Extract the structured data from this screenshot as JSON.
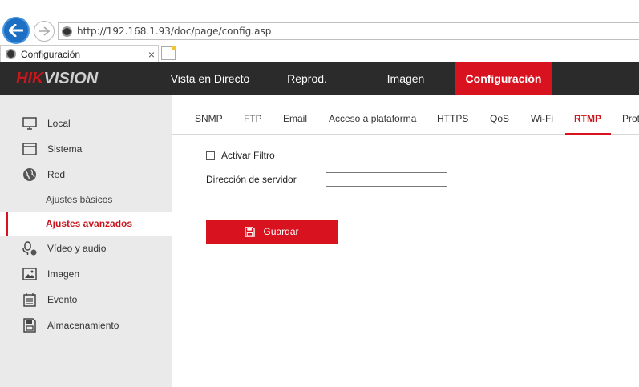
{
  "browser": {
    "url": "http://192.168.1.93/doc/page/config.asp",
    "tab_title": "Configuración",
    "tab_close": "×"
  },
  "header": {
    "logo": "HIKVISION",
    "nav": [
      "Vista en Directo",
      "Reprod.",
      "Imagen",
      "Configuración"
    ],
    "active_nav": "Configuración",
    "accent_color": "#d8121e"
  },
  "sidebar": {
    "items": [
      {
        "label": "Local",
        "icon": "monitor-icon"
      },
      {
        "label": "Sistema",
        "icon": "window-icon"
      },
      {
        "label": "Red",
        "icon": "globe-icon"
      },
      {
        "label": "Vídeo y audio",
        "icon": "microphone-icon"
      },
      {
        "label": "Imagen",
        "icon": "image-icon"
      },
      {
        "label": "Evento",
        "icon": "calendar-icon"
      },
      {
        "label": "Almacenamiento",
        "icon": "storage-icon"
      }
    ],
    "red_sub": [
      "Ajustes básicos",
      "Ajustes avanzados"
    ],
    "active_sub": "Ajustes avanzados"
  },
  "tabs": [
    "SNMP",
    "FTP",
    "Email",
    "Acceso a plataforma",
    "HTTPS",
    "QoS",
    "Wi-Fi",
    "RTMP",
    "Prot"
  ],
  "active_tab": "RTMP",
  "form": {
    "filter_label": "Activar Filtro",
    "filter_checked": false,
    "server_label": "Dirección de servidor",
    "server_value": "",
    "save_label": "Guardar"
  }
}
